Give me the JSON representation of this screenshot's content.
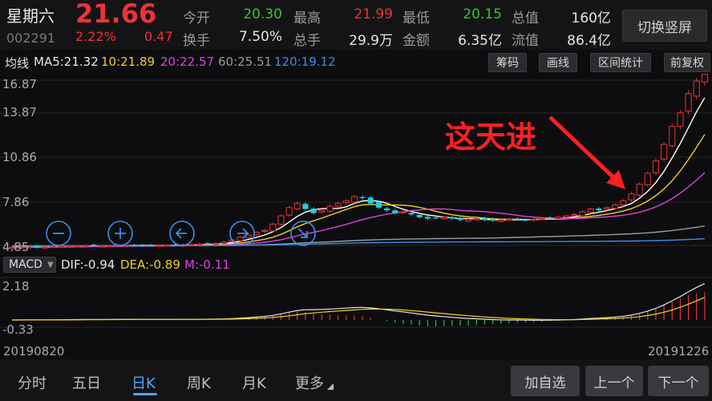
{
  "header": {
    "name": "星期六",
    "code": "002291",
    "price": "21.66",
    "change_pct": "2.22%",
    "change_abs": "0.47",
    "stats": [
      {
        "label": "今开",
        "value": "20.30",
        "color": "green"
      },
      {
        "label": "最高",
        "value": "21.99",
        "color": "red"
      },
      {
        "label": "最低",
        "value": "20.15",
        "color": "green"
      },
      {
        "label": "总值",
        "value": "160亿",
        "color": "white"
      },
      {
        "label": "换手",
        "value": "7.50%",
        "color": "white"
      },
      {
        "label": "总手",
        "value": "29.9万",
        "color": "white"
      },
      {
        "label": "金额",
        "value": "6.35亿",
        "color": "white"
      },
      {
        "label": "流值",
        "value": "86.4亿",
        "color": "white"
      }
    ],
    "switch_label": "切换竖屏"
  },
  "ma_bar": {
    "title": "均线",
    "items": [
      {
        "text": "MA5:21.32",
        "color": "#e6e6e6"
      },
      {
        "text": "10:21.89",
        "color": "#f0d020"
      },
      {
        "text": "20:22.57",
        "color": "#e040e0"
      },
      {
        "text": "60:25.51",
        "color": "#9a9a9a"
      },
      {
        "text": "120:19.12",
        "color": "#3a8ee8"
      }
    ],
    "tools": [
      "筹码",
      "画线",
      "区间统计",
      "前复权"
    ]
  },
  "main_chart": {
    "y_ticks": [
      "16.87",
      "13.87",
      "10.86",
      "7.86",
      "4.85"
    ],
    "annotation": "这天进",
    "nav_icons": [
      "minus-icon",
      "plus-icon",
      "arrow-left-icon",
      "arrow-right-icon",
      "arrow-down-right-icon"
    ]
  },
  "macd_bar": {
    "select": "MACD",
    "items": [
      {
        "text": "DIF:-0.94",
        "color": "#e6e6e6"
      },
      {
        "text": "DEA:-0.89",
        "color": "#f0d020"
      },
      {
        "text": "M:-0.11",
        "color": "#e040e0"
      }
    ],
    "y_ticks": [
      "2.18",
      "-0.33"
    ]
  },
  "x_axis": {
    "start": "20190820",
    "end": "20191226"
  },
  "footer": {
    "tabs": [
      "分时",
      "五日",
      "日K",
      "周K",
      "月K",
      "更多"
    ],
    "active_tab": "日K",
    "buttons": [
      "加自选",
      "上一个",
      "下一个"
    ]
  },
  "chart_data": {
    "type": "candlestick",
    "period": "daily",
    "x_range": [
      "20190820",
      "20191226"
    ],
    "y_range": [
      4.85,
      16.87
    ],
    "colors": {
      "up": "#ee3333",
      "down": "#22d0e0",
      "ma5": "#ffffff",
      "ma10": "#f0d020",
      "ma20": "#e040e0",
      "ma60": "#9a9a9a",
      "ma120": "#3a8ee8"
    },
    "close_series": [
      4.7,
      4.72,
      4.75,
      4.7,
      4.73,
      4.76,
      4.8,
      4.78,
      4.82,
      4.85,
      4.83,
      4.8,
      4.84,
      4.88,
      4.9,
      4.86,
      4.84,
      4.82,
      4.85,
      4.88,
      4.86,
      4.9,
      4.92,
      4.95,
      4.98,
      5.0,
      5.1,
      5.25,
      5.45,
      5.6,
      5.8,
      5.95,
      6.4,
      7.0,
      7.6,
      7.9,
      7.5,
      7.2,
      7.4,
      7.7,
      7.9,
      8.1,
      8.4,
      8.3,
      7.9,
      7.6,
      7.4,
      7.2,
      7.3,
      7.1,
      6.9,
      6.8,
      6.85,
      6.9,
      6.8,
      6.7,
      6.75,
      6.8,
      6.7,
      6.65,
      6.7,
      6.75,
      6.8,
      6.7,
      6.75,
      6.8,
      6.85,
      6.9,
      7.0,
      7.1,
      7.3,
      7.5,
      7.4,
      7.6,
      7.8,
      8.1,
      8.6,
      9.3,
      10.1,
      11.0,
      12.2,
      13.5,
      14.5,
      15.9,
      16.8,
      17.3
    ]
  }
}
